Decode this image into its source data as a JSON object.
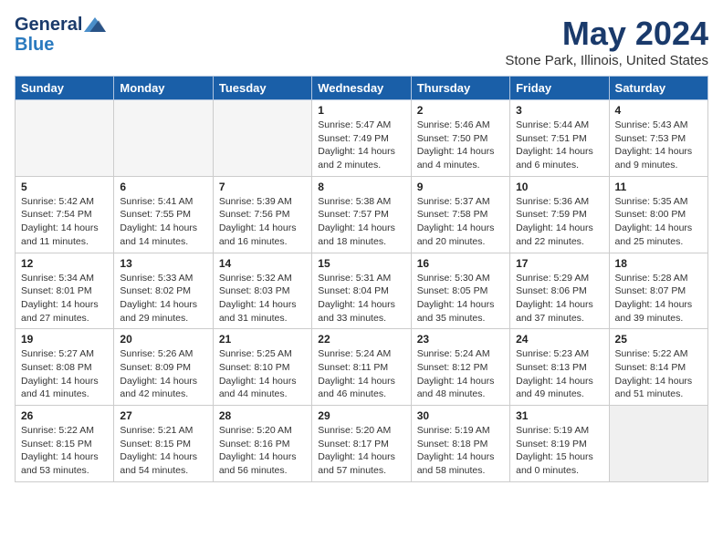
{
  "logo": {
    "line1": "General",
    "line2": "Blue"
  },
  "header": {
    "month": "May 2024",
    "location": "Stone Park, Illinois, United States"
  },
  "weekdays": [
    "Sunday",
    "Monday",
    "Tuesday",
    "Wednesday",
    "Thursday",
    "Friday",
    "Saturday"
  ],
  "weeks": [
    [
      {
        "day": "",
        "content": ""
      },
      {
        "day": "",
        "content": ""
      },
      {
        "day": "",
        "content": ""
      },
      {
        "day": "1",
        "content": "Sunrise: 5:47 AM\nSunset: 7:49 PM\nDaylight: 14 hours\nand 2 minutes."
      },
      {
        "day": "2",
        "content": "Sunrise: 5:46 AM\nSunset: 7:50 PM\nDaylight: 14 hours\nand 4 minutes."
      },
      {
        "day": "3",
        "content": "Sunrise: 5:44 AM\nSunset: 7:51 PM\nDaylight: 14 hours\nand 6 minutes."
      },
      {
        "day": "4",
        "content": "Sunrise: 5:43 AM\nSunset: 7:53 PM\nDaylight: 14 hours\nand 9 minutes."
      }
    ],
    [
      {
        "day": "5",
        "content": "Sunrise: 5:42 AM\nSunset: 7:54 PM\nDaylight: 14 hours\nand 11 minutes."
      },
      {
        "day": "6",
        "content": "Sunrise: 5:41 AM\nSunset: 7:55 PM\nDaylight: 14 hours\nand 14 minutes."
      },
      {
        "day": "7",
        "content": "Sunrise: 5:39 AM\nSunset: 7:56 PM\nDaylight: 14 hours\nand 16 minutes."
      },
      {
        "day": "8",
        "content": "Sunrise: 5:38 AM\nSunset: 7:57 PM\nDaylight: 14 hours\nand 18 minutes."
      },
      {
        "day": "9",
        "content": "Sunrise: 5:37 AM\nSunset: 7:58 PM\nDaylight: 14 hours\nand 20 minutes."
      },
      {
        "day": "10",
        "content": "Sunrise: 5:36 AM\nSunset: 7:59 PM\nDaylight: 14 hours\nand 22 minutes."
      },
      {
        "day": "11",
        "content": "Sunrise: 5:35 AM\nSunset: 8:00 PM\nDaylight: 14 hours\nand 25 minutes."
      }
    ],
    [
      {
        "day": "12",
        "content": "Sunrise: 5:34 AM\nSunset: 8:01 PM\nDaylight: 14 hours\nand 27 minutes."
      },
      {
        "day": "13",
        "content": "Sunrise: 5:33 AM\nSunset: 8:02 PM\nDaylight: 14 hours\nand 29 minutes."
      },
      {
        "day": "14",
        "content": "Sunrise: 5:32 AM\nSunset: 8:03 PM\nDaylight: 14 hours\nand 31 minutes."
      },
      {
        "day": "15",
        "content": "Sunrise: 5:31 AM\nSunset: 8:04 PM\nDaylight: 14 hours\nand 33 minutes."
      },
      {
        "day": "16",
        "content": "Sunrise: 5:30 AM\nSunset: 8:05 PM\nDaylight: 14 hours\nand 35 minutes."
      },
      {
        "day": "17",
        "content": "Sunrise: 5:29 AM\nSunset: 8:06 PM\nDaylight: 14 hours\nand 37 minutes."
      },
      {
        "day": "18",
        "content": "Sunrise: 5:28 AM\nSunset: 8:07 PM\nDaylight: 14 hours\nand 39 minutes."
      }
    ],
    [
      {
        "day": "19",
        "content": "Sunrise: 5:27 AM\nSunset: 8:08 PM\nDaylight: 14 hours\nand 41 minutes."
      },
      {
        "day": "20",
        "content": "Sunrise: 5:26 AM\nSunset: 8:09 PM\nDaylight: 14 hours\nand 42 minutes."
      },
      {
        "day": "21",
        "content": "Sunrise: 5:25 AM\nSunset: 8:10 PM\nDaylight: 14 hours\nand 44 minutes."
      },
      {
        "day": "22",
        "content": "Sunrise: 5:24 AM\nSunset: 8:11 PM\nDaylight: 14 hours\nand 46 minutes."
      },
      {
        "day": "23",
        "content": "Sunrise: 5:24 AM\nSunset: 8:12 PM\nDaylight: 14 hours\nand 48 minutes."
      },
      {
        "day": "24",
        "content": "Sunrise: 5:23 AM\nSunset: 8:13 PM\nDaylight: 14 hours\nand 49 minutes."
      },
      {
        "day": "25",
        "content": "Sunrise: 5:22 AM\nSunset: 8:14 PM\nDaylight: 14 hours\nand 51 minutes."
      }
    ],
    [
      {
        "day": "26",
        "content": "Sunrise: 5:22 AM\nSunset: 8:15 PM\nDaylight: 14 hours\nand 53 minutes."
      },
      {
        "day": "27",
        "content": "Sunrise: 5:21 AM\nSunset: 8:15 PM\nDaylight: 14 hours\nand 54 minutes."
      },
      {
        "day": "28",
        "content": "Sunrise: 5:20 AM\nSunset: 8:16 PM\nDaylight: 14 hours\nand 56 minutes."
      },
      {
        "day": "29",
        "content": "Sunrise: 5:20 AM\nSunset: 8:17 PM\nDaylight: 14 hours\nand 57 minutes."
      },
      {
        "day": "30",
        "content": "Sunrise: 5:19 AM\nSunset: 8:18 PM\nDaylight: 14 hours\nand 58 minutes."
      },
      {
        "day": "31",
        "content": "Sunrise: 5:19 AM\nSunset: 8:19 PM\nDaylight: 15 hours\nand 0 minutes."
      },
      {
        "day": "",
        "content": ""
      }
    ]
  ]
}
